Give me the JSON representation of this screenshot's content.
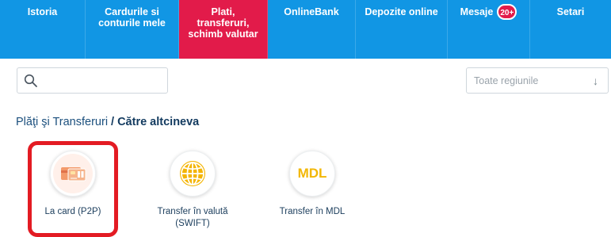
{
  "nav": {
    "items": [
      {
        "label": "Istoria"
      },
      {
        "label": "Cardurile si\nconturile mele"
      },
      {
        "label": "Plati,\ntransferuri,\nschimb valutar"
      },
      {
        "label": "OnlineBank"
      },
      {
        "label": "Depozite online"
      },
      {
        "label": "Mesaje",
        "badge": "20+"
      },
      {
        "label": "Setari"
      }
    ],
    "active_index": 2,
    "colors": {
      "bar": "#1196e4",
      "active": "#e21b4a"
    }
  },
  "search": {
    "placeholder": "",
    "icon": "search-icon"
  },
  "region_select": {
    "selected": "Toate regiunile",
    "icon": "arrow-down-icon"
  },
  "breadcrumb": {
    "link": "Plăţi şi Transferuri",
    "separator": "/",
    "current": "Către altcineva"
  },
  "options": [
    {
      "label": "La card (P2P)",
      "icon": "card-icon"
    },
    {
      "label": "Transfer în valută\n(SWIFT)",
      "icon": "globe-icon"
    },
    {
      "label": "Transfer în MDL",
      "icon": "mdl-icon",
      "icon_text": "MDL"
    }
  ],
  "highlight_color": "#e31b23"
}
